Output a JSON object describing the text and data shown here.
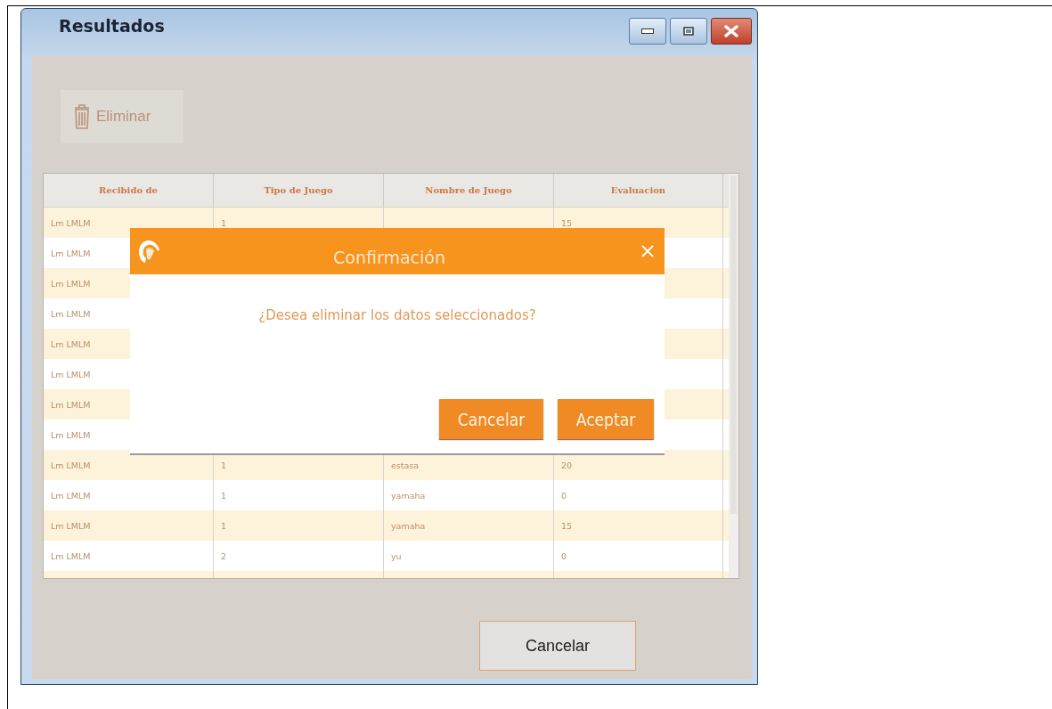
{
  "window": {
    "title": "Resultados"
  },
  "toolbar": {
    "delete_button": {
      "label": "Eliminar",
      "disabled": true
    }
  },
  "table": {
    "columns": [
      "Recibido de",
      "Tipo de Juego",
      "Nombre de Juego",
      "Evaluacion"
    ],
    "rows": [
      {
        "recibido_de": "Lm LMLM",
        "tipo_de_juego": "1",
        "evaluacion": "15"
      },
      {
        "recibido_de": "Lm LMLM"
      },
      {
        "recibido_de": "Lm LMLM"
      },
      {
        "recibido_de": "Lm LMLM"
      },
      {
        "recibido_de": "Lm LMLM"
      },
      {
        "recibido_de": "Lm LMLM"
      },
      {
        "recibido_de": "Lm LMLM"
      },
      {
        "recibido_de": "Lm LMLM"
      },
      {
        "recibido_de": "Lm LMLM",
        "tipo_de_juego": "1",
        "nombre_de_juego": "estasa",
        "evaluacion": "20"
      },
      {
        "recibido_de": "Lm LMLM",
        "tipo_de_juego": "1",
        "nombre_de_juego": "yamaha",
        "evaluacion": "0"
      },
      {
        "recibido_de": "Lm LMLM",
        "tipo_de_juego": "1",
        "nombre_de_juego": "yamaha",
        "evaluacion": "15"
      },
      {
        "recibido_de": "Lm LMLM",
        "tipo_de_juego": "2",
        "nombre_de_juego": "yu",
        "evaluacion": "0"
      },
      {}
    ]
  },
  "dialog": {
    "title": "Confirmación",
    "message": "¿Desea eliminar los datos seleccionados?",
    "buttons": [
      "Cancelar",
      "Aceptar"
    ]
  },
  "footer": {
    "cancel_button": "Cancelar"
  }
}
